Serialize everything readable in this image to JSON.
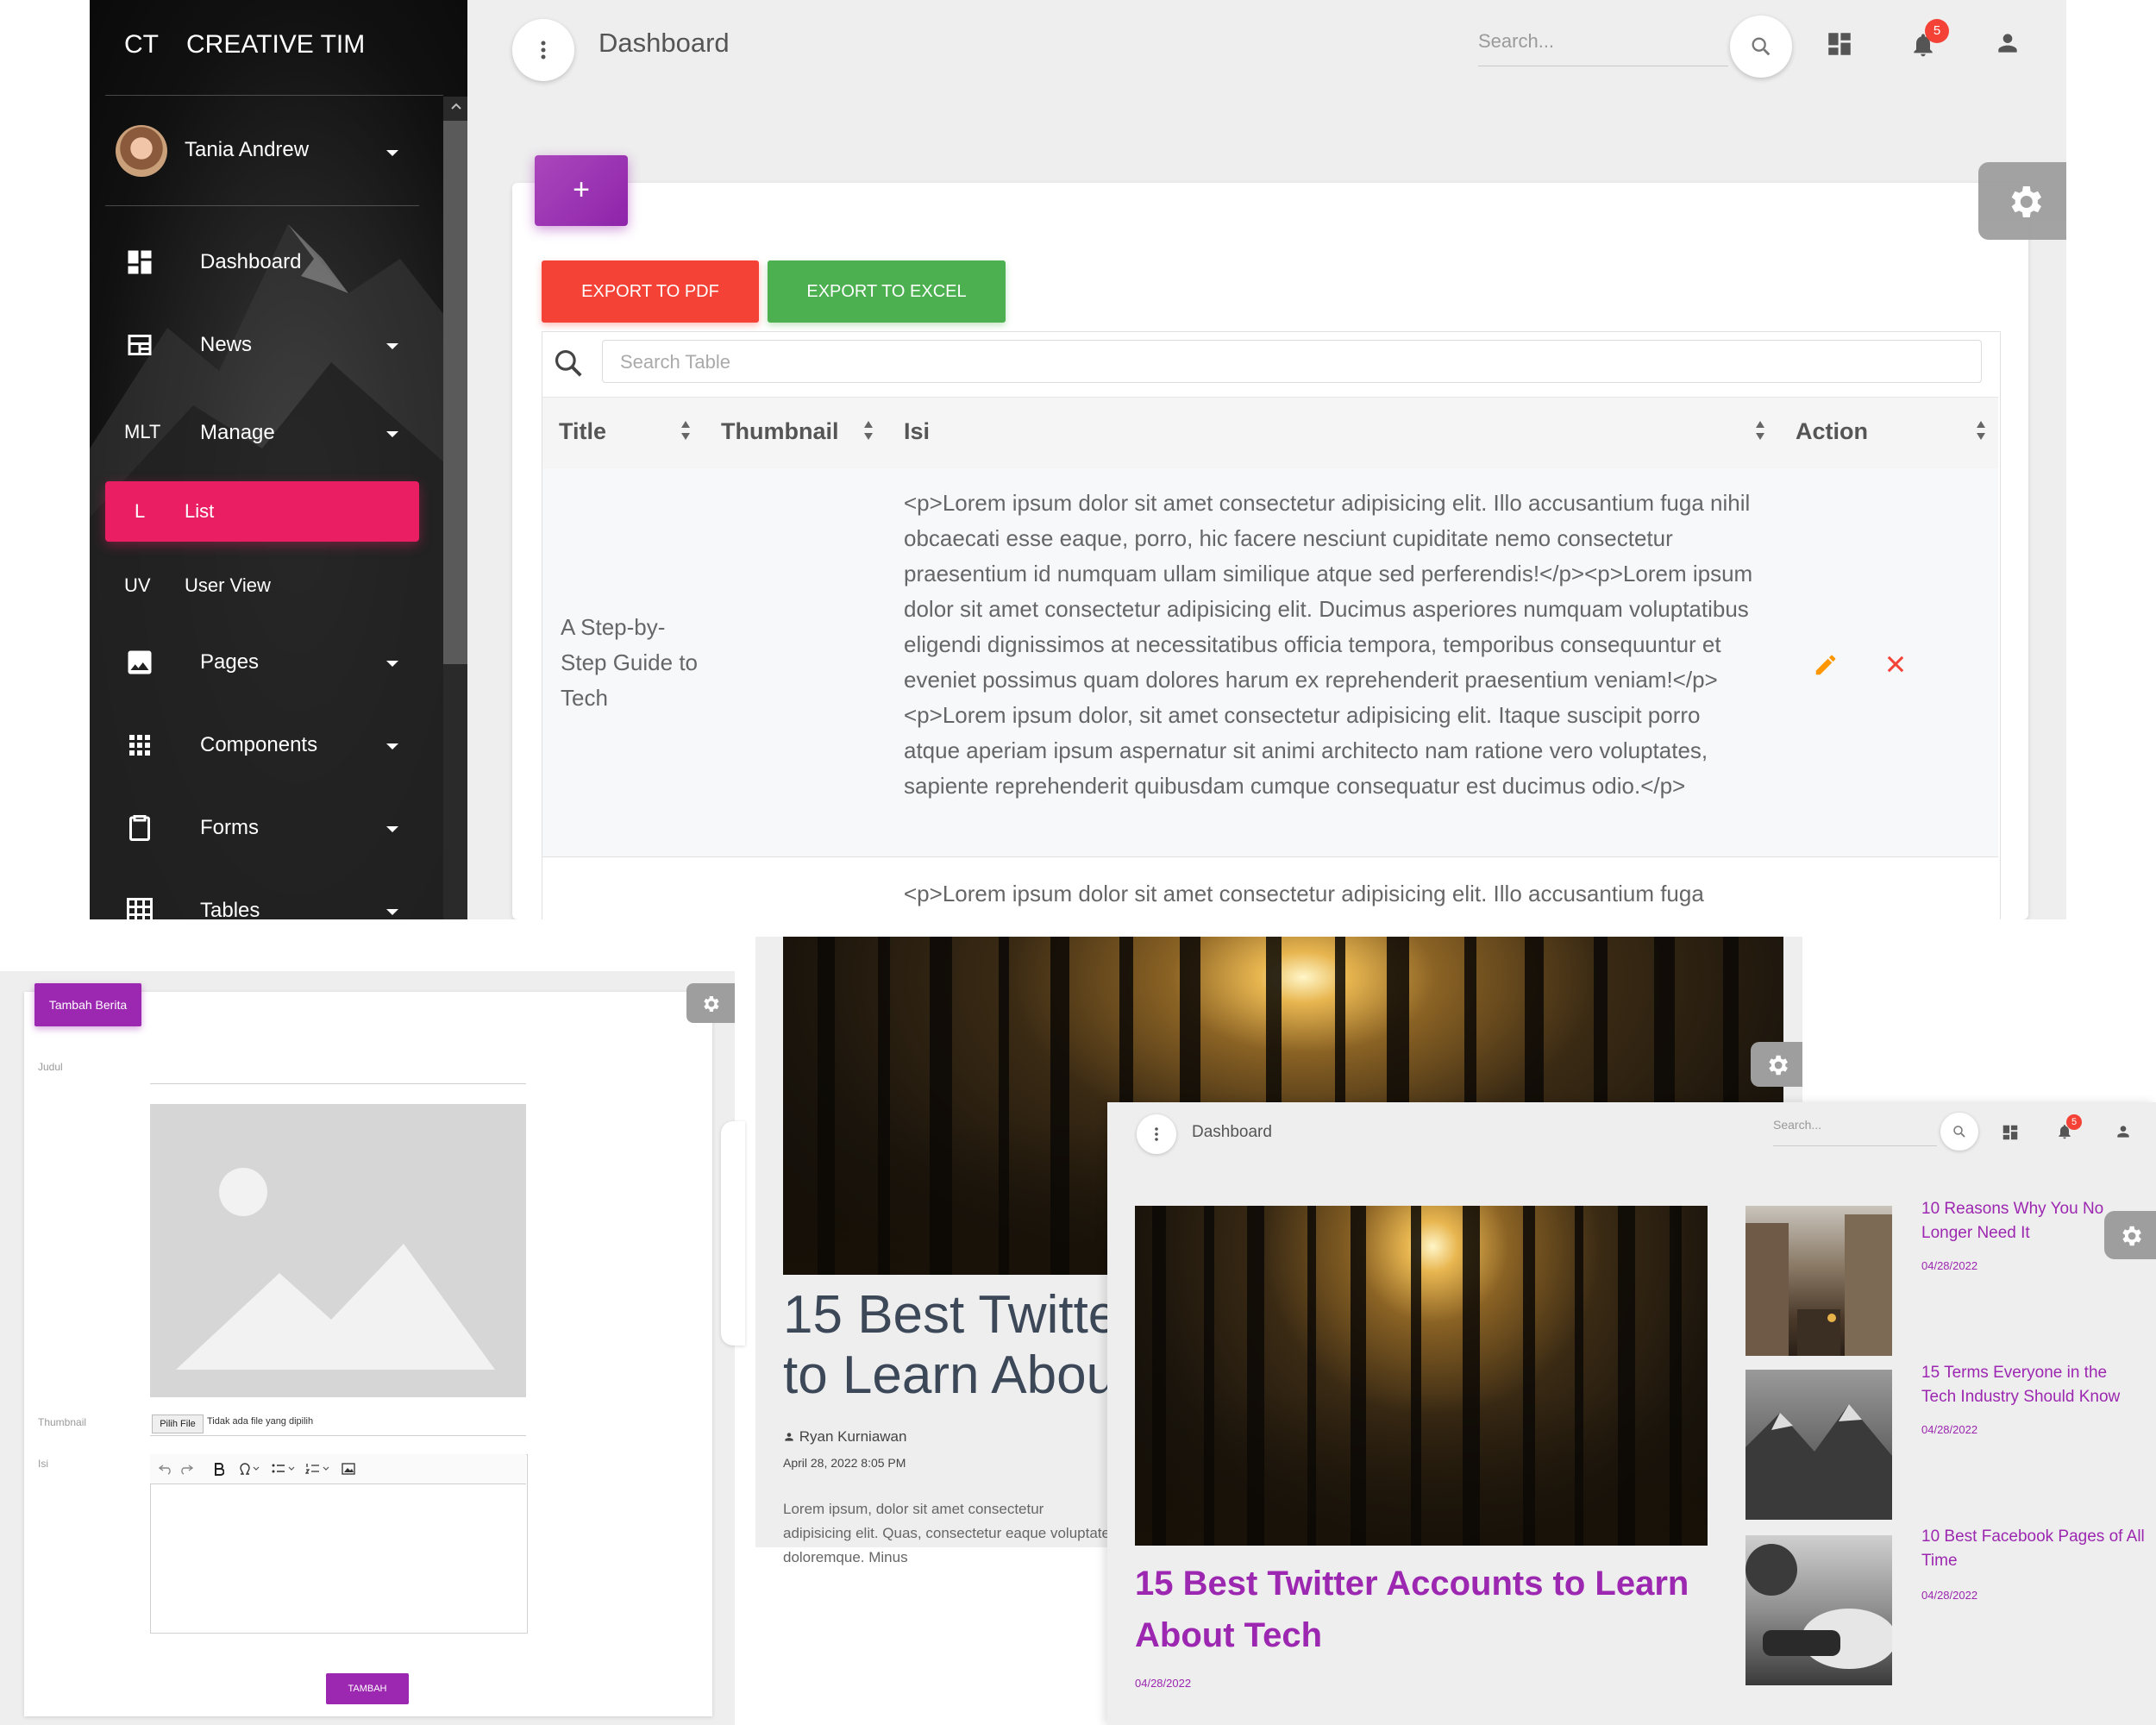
{
  "colors": {
    "primary": "#9c27b0",
    "active_pink": "#e91e63",
    "danger": "#f44336",
    "success": "#4caf50",
    "edit_orange": "#ff9800"
  },
  "sidebar": {
    "brand_mini": "CT",
    "brand_name": "CREATIVE TIM",
    "user_name": "Tania Andrew",
    "items": [
      {
        "label": "Dashboard",
        "icon": "dashboard-icon"
      },
      {
        "label": "News",
        "icon": "news-icon"
      },
      {
        "label": "Manage",
        "mini": "MLT"
      },
      {
        "label": "List",
        "mini": "L"
      },
      {
        "label": "User View",
        "mini": "UV"
      },
      {
        "label": "Pages",
        "icon": "image-icon"
      },
      {
        "label": "Components",
        "icon": "apps-icon"
      },
      {
        "label": "Forms",
        "icon": "clipboard-icon"
      },
      {
        "label": "Tables",
        "icon": "grid-icon"
      }
    ]
  },
  "navbar": {
    "title": "Dashboard",
    "search_placeholder": "Search...",
    "notification_count": "5"
  },
  "table": {
    "add_label": "+",
    "export_pdf": "EXPORT TO PDF",
    "export_excel": "EXPORT TO EXCEL",
    "search_placeholder": "Search Table",
    "columns": [
      "Title",
      "Thumbnail",
      "Isi",
      "Action"
    ],
    "rows": [
      {
        "title": "A Step-by-Step Guide to Tech",
        "isi": "<p>Lorem ipsum dolor sit amet consectetur adipisicing elit. Illo accusantium fuga nihil obcaecati esse eaque, porro, hic facere nesciunt cupiditate nemo consectetur praesentium id numquam ullam similique atque sed perferendis!</p><p>Lorem ipsum dolor sit amet consectetur adipisicing elit. Ducimus asperiores numquam voluptatibus eligendi dignissimos at necessitatibus officia tempora, temporibus consequuntur et eveniet possimus quam dolores harum ex reprehenderit praesentium veniam!</p><p>Lorem ipsum dolor, sit amet consectetur adipisicing elit. Itaque suscipit porro atque aperiam ipsum aspernatur sit animi architecto nam ratione vero voluptates, sapiente reprehenderit quibusdam cumque consequatur est ducimus odio.</p>"
      },
      {
        "isi": "<p>Lorem ipsum dolor sit amet consectetur adipisicing elit. Illo accusantium fuga"
      }
    ]
  },
  "form": {
    "add_button": "Tambah Berita",
    "judul_label": "Judul",
    "thumbnail_label": "Thumbnail",
    "isi_label": "Isi",
    "file_button": "Pilih File",
    "file_status": "Tidak ada file yang dipilih",
    "submit": "TAMBAH"
  },
  "article": {
    "title": "15 Best Twitter Accounts to Learn About Tech",
    "author": "Ryan Kurniawan",
    "datetime": "April 28, 2022 8:05 PM",
    "excerpt": "Lorem ipsum, dolor sit amet consectetur adipisicing elit. Quas, consectetur eaque voluptate doloremque. Minus"
  },
  "news_page": {
    "title": "Dashboard",
    "search_placeholder": "Search...",
    "notification_count": "5",
    "main_title": "15 Best Twitter Accounts to Learn About Tech",
    "main_date": "04/28/2022",
    "side": [
      {
        "title": "10 Reasons Why You No Longer Need It",
        "date": "04/28/2022"
      },
      {
        "title": "15 Terms Everyone in the Tech Industry Should Know",
        "date": "04/28/2022"
      },
      {
        "title": "10 Best Facebook Pages of All Time",
        "date": "04/28/2022"
      }
    ]
  }
}
